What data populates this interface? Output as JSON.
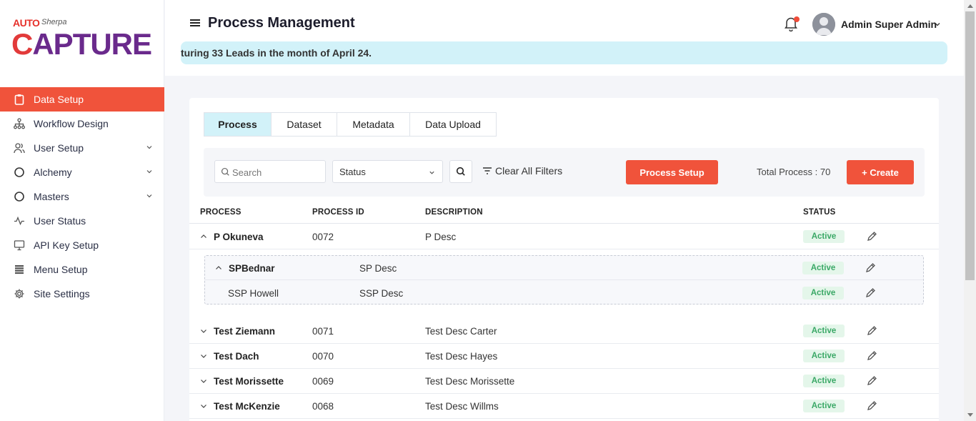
{
  "logo": {
    "auto": "AUTO",
    "sherpa": "Sherpa",
    "capture_c": "C",
    "capture_rest": "APTURE"
  },
  "sidebar": {
    "items": [
      {
        "label": "Data Setup",
        "icon": "clipboard-icon"
      },
      {
        "label": "Workflow Design",
        "icon": "sitemap-icon"
      },
      {
        "label": "User Setup",
        "icon": "users-icon"
      },
      {
        "label": "Alchemy",
        "icon": "circle-icon"
      },
      {
        "label": "Masters",
        "icon": "circle-icon"
      },
      {
        "label": "User Status",
        "icon": "activity-icon"
      },
      {
        "label": "API Key Setup",
        "icon": "monitor-icon"
      },
      {
        "label": "Menu Setup",
        "icon": "list-icon"
      },
      {
        "label": "Site Settings",
        "icon": "gear-icon"
      }
    ]
  },
  "header": {
    "title": "Process Management",
    "user_name": "Admin Super Admin",
    "banner": "turing 33 Leads in the month of April 24."
  },
  "tabs": [
    {
      "label": "Process"
    },
    {
      "label": "Dataset"
    },
    {
      "label": "Metadata"
    },
    {
      "label": "Data Upload"
    }
  ],
  "filters": {
    "search_placeholder": "Search",
    "status_label": "Status",
    "clear_label": "Clear All Filters",
    "process_setup_label": "Process Setup",
    "total_label": "Total Process : 70",
    "create_label": "+ Create"
  },
  "table": {
    "columns": [
      "PROCESS",
      "PROCESS ID",
      "DESCRIPTION",
      "STATUS"
    ],
    "rows": [
      {
        "process": "P Okuneva",
        "id": "0072",
        "description": "P Desc",
        "status": "Active",
        "expanded": true
      },
      {
        "process": "Test Ziemann",
        "id": "0071",
        "description": "Test Desc Carter",
        "status": "Active",
        "expanded": false
      },
      {
        "process": "Test Dach",
        "id": "0070",
        "description": "Test Desc Hayes",
        "status": "Active",
        "expanded": false
      },
      {
        "process": "Test Morissette",
        "id": "0069",
        "description": "Test Desc Morissette",
        "status": "Active",
        "expanded": false
      },
      {
        "process": "Test McKenzie",
        "id": "0068",
        "description": "Test Desc Willms",
        "status": "Active",
        "expanded": false
      }
    ],
    "subrows": [
      {
        "process": "SPBednar",
        "description": "SP Desc",
        "status": "Active"
      },
      {
        "process": "SSP Howell",
        "description": "SSP Desc",
        "status": "Active"
      }
    ]
  },
  "colors": {
    "accent": "#f0533b",
    "tab_active": "#d2f2f9",
    "badge_bg": "#e4f6ea",
    "badge_text": "#3aa866",
    "logo_purple": "#6a2a8c"
  }
}
